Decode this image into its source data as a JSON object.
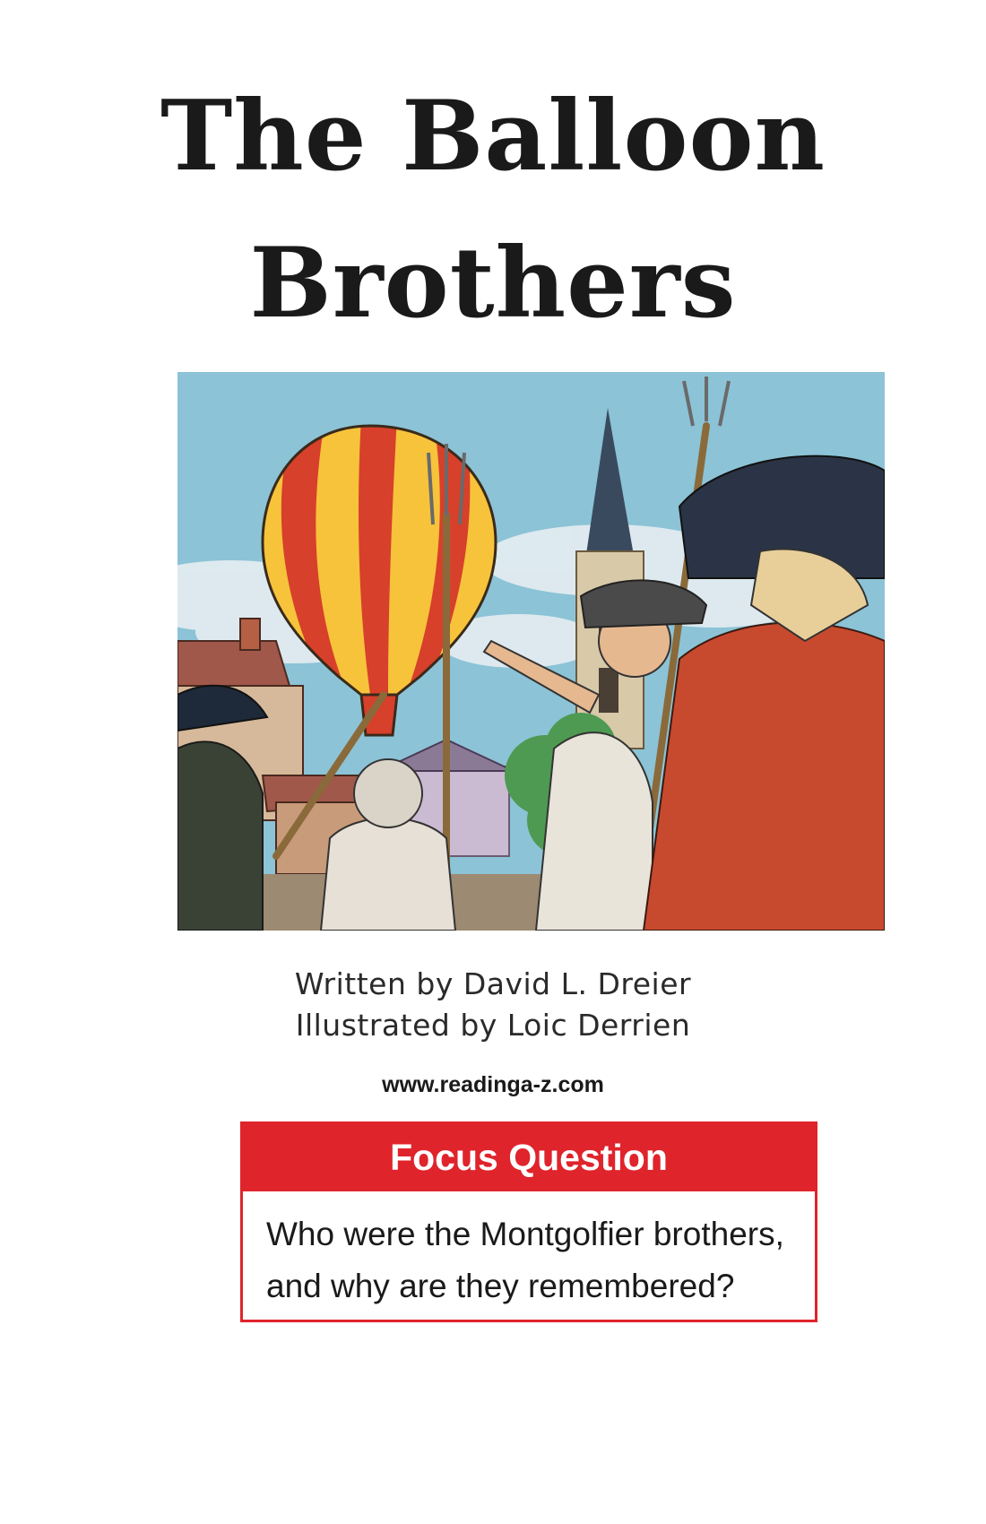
{
  "book": {
    "title_line_1": "The Balloon",
    "title_line_2": "Brothers",
    "written_by": "Written by David L. Dreier",
    "illustrated_by": "Illustrated by Loic Derrien",
    "website": "www.readinga-z.com"
  },
  "focus": {
    "heading": "Focus Question",
    "question": "Who were the Montgolfier brothers, and why are they remembered?",
    "accent_color": "#e0242c"
  },
  "illustration": {
    "subject": "hot-air-balloon-village-crowd"
  }
}
